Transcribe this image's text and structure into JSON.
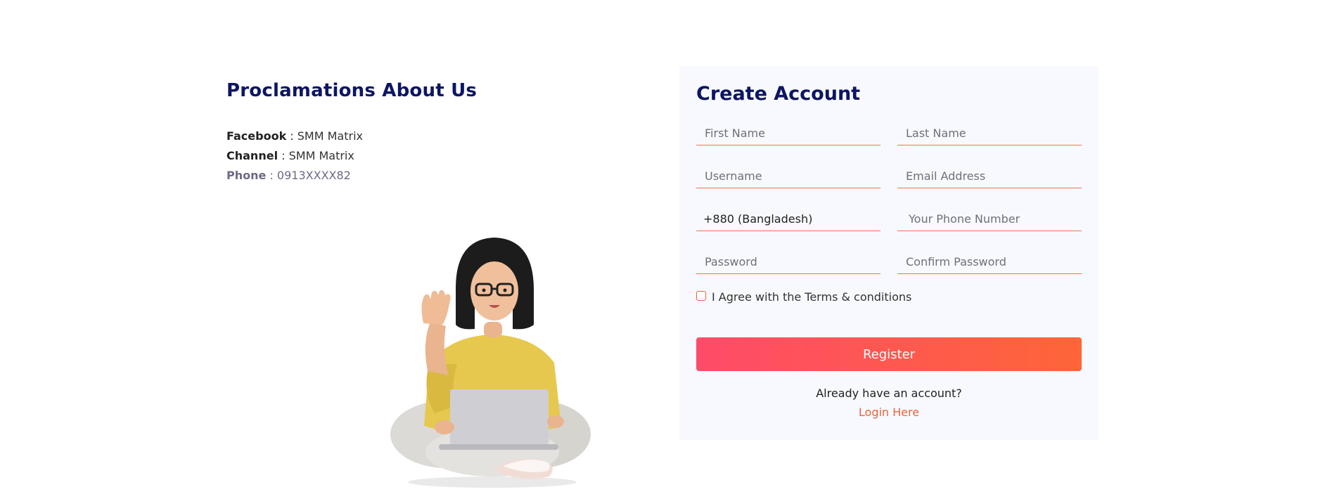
{
  "about": {
    "title": "Proclamations About Us",
    "facebook_label": "Facebook",
    "facebook_value": " : SMM Matrix",
    "channel_label": "Channel",
    "channel_value": " : SMM Matrix",
    "phone_label": "Phone",
    "phone_value": " :  0913XXXX82"
  },
  "illustration": {
    "icon": "woman-with-laptop-illustration"
  },
  "form": {
    "title": "Create Account",
    "first_name_placeholder": "First Name",
    "last_name_placeholder": "Last Name",
    "username_placeholder": "Username",
    "email_placeholder": "Email Address",
    "country_code_value": "+880 (Bangladesh)",
    "phone_placeholder": "Your Phone Number",
    "password_placeholder": "Password",
    "confirm_password_placeholder": "Confirm Password",
    "agree_label": "I Agree with the Terms & conditions",
    "register_label": "Register",
    "have_account_text": "Already have an account?",
    "login_link": "Login Here"
  },
  "colors": {
    "heading": "#0d1564",
    "accent": "#f0623a",
    "button_gradient_start": "#fe4b69",
    "button_gradient_end": "#fe6538",
    "card_background": "#f8f9fe"
  }
}
